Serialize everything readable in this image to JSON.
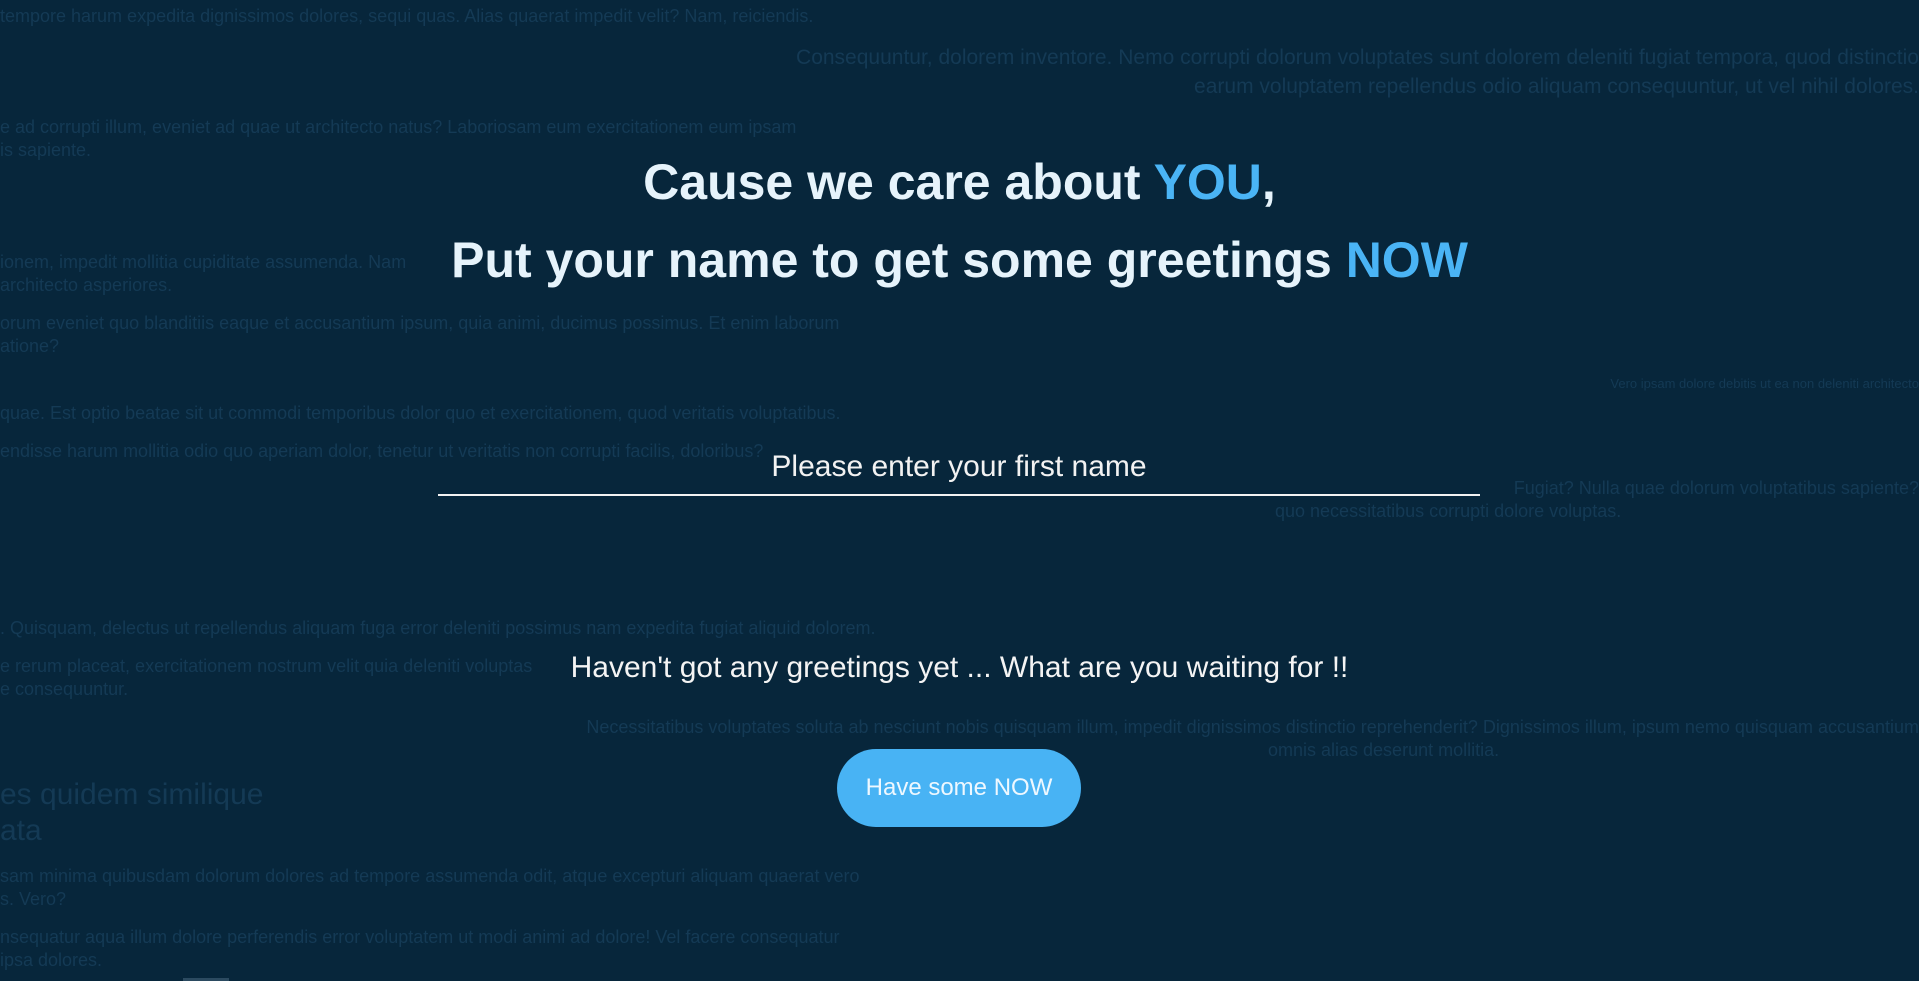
{
  "background_lines": [
    "tempore harum expedita dignissimos dolores, sequi quas. Alias quaerat impedit velit? Nam, reiciendis.",
    "Consequuntur, dolorem inventore. Nemo corrupti dolorum voluptates sunt dolorem deleniti fugiat tempora, quod distinctio",
    "earum voluptatem repellendus odio aliquam consequuntur, ut vel nihil dolores.",
    "e ad corrupti illum, eveniet ad quae ut architecto natus? Laboriosam eum exercitationem eum ipsam",
    "is sapiente.",
    "ionem, impedit mollitia cupiditate assumenda. Nam",
    "architecto asperiores.",
    "orum eveniet quo blanditiis eaque et accusantium ipsum, quia animi, ducimus possimus. Et enim laborum",
    "atione?",
    "Vero ipsam dolore debitis ut ea non deleniti architecto",
    "quae. Est optio beatae sit ut commodi temporibus dolor quo et exercitationem, quod veritatis voluptatibus.",
    "endisse harum mollitia odio quo aperiam dolor, tenetur ut veritatis non corrupti facilis, doloribus?",
    "Fugiat? Nulla quae dolorum voluptatibus sapiente?",
    "quo necessitatibus corrupti dolore voluptas.",
    ". Quisquam, delectus ut repellendus aliquam fuga error deleniti possimus nam expedita fugiat aliquid dolorem.",
    "e rerum placeat, exercitationem nostrum velit quia deleniti voluptas",
    "e consequuntur.",
    "Necessitatibus voluptates soluta ab nesciunt nobis quisquam illum, impedit dignissimos distinctio reprehenderit? Dignissimos illum, ipsum nemo quisquam accusantium",
    "omnis alias deserunt mollitia.",
    "es quidem similique",
    "ata",
    "sam minima quibusdam dolorum dolores ad tempore assumenda odit, atque excepturi aliquam quaerat vero",
    "s. Vero?",
    "nsequatur aqua illum dolore perferendis error voluptatem ut modi animi ad dolore! Vel facere consequatur",
    "ipsa dolores."
  ],
  "headline": {
    "line1_prefix": "Cause we care about ",
    "line1_accent": "YOU",
    "line1_suffix": ",",
    "line2_prefix": "Put your name to get some greetings ",
    "line2_accent": "NOW"
  },
  "name_input": {
    "value": "",
    "placeholder": "Please enter your first name"
  },
  "status_message": "Haven't got any greetings yet ... What are you waiting for !!",
  "cta_button": {
    "label": "Have some NOW"
  },
  "colors": {
    "background": "#07263b",
    "accent": "#4ab4f5",
    "headline": "#e6f3fb",
    "button": "#48b3f4"
  }
}
